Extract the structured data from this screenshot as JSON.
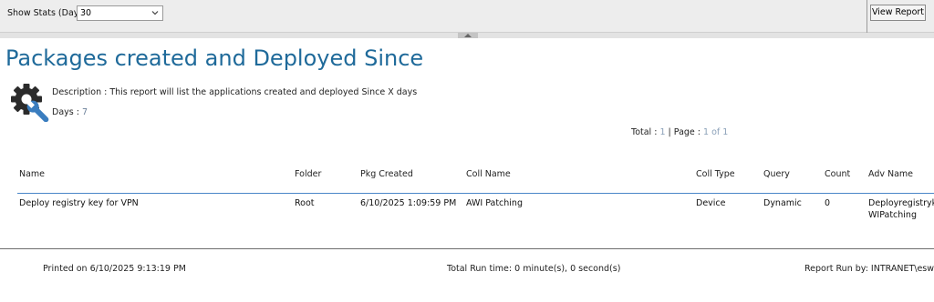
{
  "toolbar": {
    "param_label": "Show Stats (Days)",
    "param_value": "30",
    "view_report_label": "View Report"
  },
  "report": {
    "title": "Packages created and Deployed Since",
    "description": "Description : This report will list the applications created and deployed Since X days",
    "days_label": "Days :",
    "days_value": "7",
    "total_label": "Total :",
    "total_value": "1",
    "page_sep": "|",
    "page_label": "Page :",
    "page_value": "1 of 1"
  },
  "table": {
    "columns": [
      "Name",
      "Folder",
      "Pkg Created",
      "Coll Name",
      "Coll Type",
      "Query",
      "Count",
      "Adv Name"
    ],
    "rows": [
      {
        "name": "Deploy registry key for VPN",
        "folder": "Root",
        "pkg_created": "6/10/2025 1:09:59 PM",
        "coll_name": "AWI Patching",
        "coll_type": "Device",
        "query": "Dynamic",
        "count": "0",
        "adv_name_line1": "Deployregistryke",
        "adv_name_line2": "WIPatching"
      }
    ]
  },
  "footer": {
    "printed_on": "Printed on 6/10/2025 9:13:19 PM",
    "run_time": "Total Run time: 0 minute(s), 0 second(s)",
    "run_by": "Report Run by: INTRANET\\eswar"
  },
  "icons": {
    "gear": "gear-wrench-icon",
    "dropdown": "chevron-down-icon",
    "collapse": "chevron-up-icon"
  },
  "colors": {
    "title": "#1f6a9a",
    "header_rule": "#4a86c8",
    "toolbar_bg": "#ededed"
  }
}
